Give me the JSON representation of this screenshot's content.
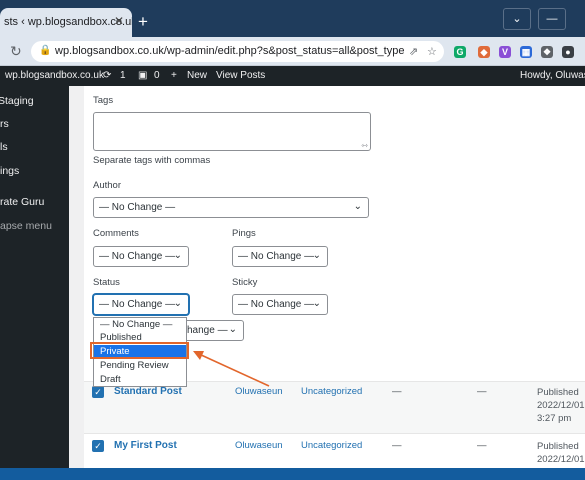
{
  "browser": {
    "tab_title": "sts ‹ wp.blogsandbox.co.uk —",
    "tab_close": "✕",
    "new_tab": "+",
    "url": "wp.blogsandbox.co.uk/wp-admin/edit.php?s&post_status=all&post_type=pos...",
    "window_buttons": [
      "⌄",
      "—"
    ]
  },
  "adminbar": {
    "site": "wp.blogsandbox.co.uk",
    "updates": "1",
    "comments": "0",
    "new": "New",
    "view_posts": "View Posts",
    "howdy": "Howdy, Oluwase"
  },
  "sidebar": {
    "items": [
      "Staging",
      "rs",
      "ls",
      "ings",
      "rate Guru",
      "apse menu"
    ]
  },
  "bulk_edit": {
    "tags_label": "Tags",
    "tags_hint": "Separate tags with commas",
    "author_label": "Author",
    "author_value": "— No Change —",
    "comments_label": "Comments",
    "comments_value": "— No Change —",
    "pings_label": "Pings",
    "pings_value": "— No Change —",
    "status_label": "Status",
    "status_value": "— No Change —",
    "sticky_label": "Sticky",
    "sticky_value": "— No Change —",
    "format_value": "hange —",
    "status_options": [
      "— No Change —",
      "Published",
      "Private",
      "Pending Review",
      "Draft"
    ],
    "status_selected": "Private"
  },
  "posts": [
    {
      "title": "Standard Post",
      "author": "Oluwaseun",
      "category": "Uncategorized",
      "tags": "—",
      "comments": "—",
      "date_status": "Published",
      "date": "2022/12/01",
      "time": "3:27 pm"
    },
    {
      "title": "My First Post",
      "author": "Oluwaseun",
      "category": "Uncategorized",
      "tags": "—",
      "comments": "—",
      "date_status": "Published",
      "date": "2022/12/01",
      "time": ""
    }
  ],
  "colors": {
    "accent": "#2271b1",
    "annotation": "#e2662c",
    "admin_dark": "#1d2327"
  }
}
